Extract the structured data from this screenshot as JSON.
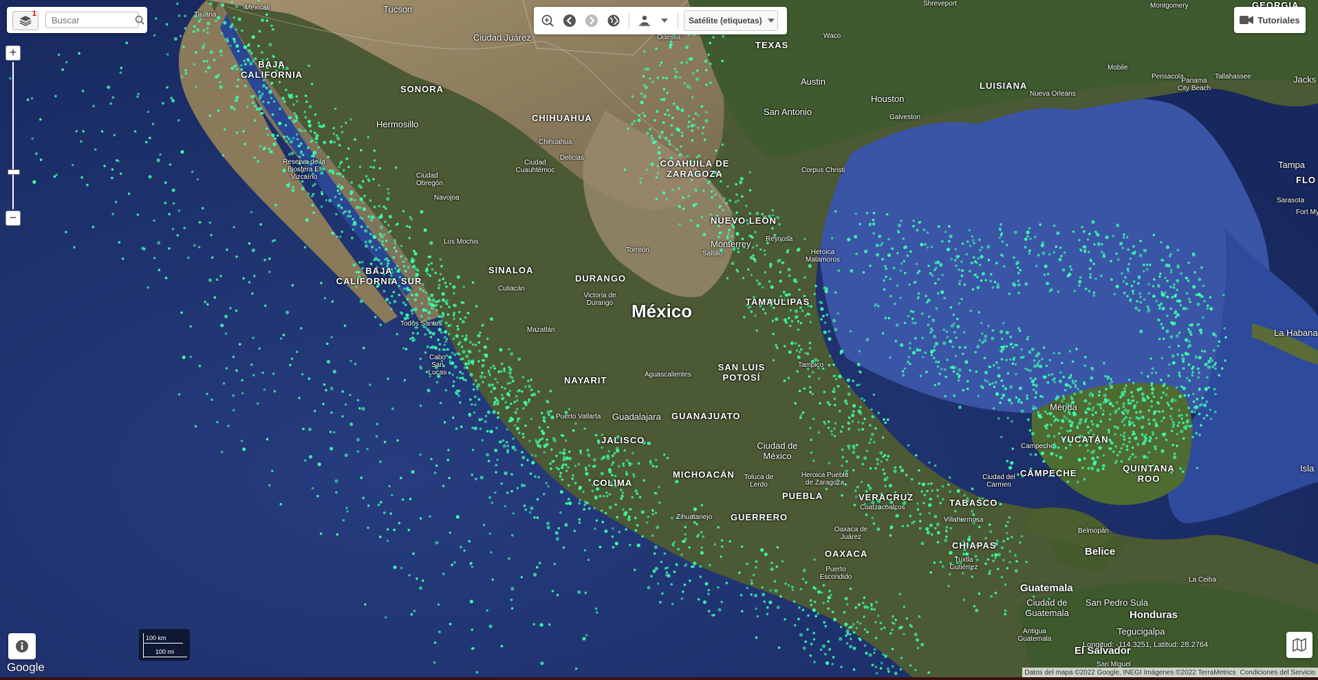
{
  "search": {
    "placeholder": "Buscar",
    "layers_badge": "1"
  },
  "toolbar": {
    "basemap": "Satélite (etiquetas)"
  },
  "tutorials": {
    "label": "Tutoriales"
  },
  "map_labels": {
    "mexicali": "Mexicali",
    "tucson": "Tucson",
    "ciudad_juarez": "Ciudad Juárez",
    "odessa": "Odessa",
    "shreveport": "Shreveport",
    "montgomery": "Montgomery",
    "georgia": "GEORGIA",
    "waco": "Waco",
    "texas": "TEXAS",
    "tijuana": "Tijuana",
    "baja_california": "BAJA CALIFORNIA",
    "sonora": "SONORA",
    "chihuahua_state": "CHIHUAHUA",
    "hermosillo": "Hermosillo",
    "chihuahua_city": "Chihuahua",
    "delicias": "Delicias",
    "coahuila": "COAHUILA DE ZARAGOZA",
    "austin": "Austin",
    "houston": "Houston",
    "luisiana": "LUISIANA",
    "mobile": "Mobile",
    "pensacola": "Pensacola",
    "tallahassee": "Tallahassee",
    "jacksonville": "Jacks",
    "panama_city": "Panama City Beach",
    "new_orleans": "Nueva Orleans",
    "galveston": "Galveston",
    "san_antonio": "San Antonio",
    "corpus_christi": "Corpus Christi",
    "tampa": "Tampa",
    "florida": "FLO",
    "sarasota": "Sarasota",
    "fort_myers": "Fort My",
    "vizcaino": "Reserva de la Biosfera El Vizcaíno",
    "ciudad_obregon": "Ciudad Obregón",
    "ciudad_cuauhtemoc": "Ciudad Cuauhtémoc",
    "navojoa": "Navojoa",
    "los_mochis": "Los Mochis",
    "culiacan": "Culiacán",
    "sinaloa": "SINALOA",
    "durango": "DURANGO",
    "torreon": "Torreón",
    "saltillo": "Saltillo",
    "monterrey": "Monterrey",
    "nuevo_leon": "NUEVO LEÓN",
    "reynosa": "Reynosa",
    "matamoros": "Heroica Matamoros",
    "bcs": "BAJA CALIFORNIA SUR",
    "mexico": "México",
    "tamaulipas": "TAMAULIPAS",
    "victoria_durango": "Victoria de Durango",
    "mazatlan": "Mazatlán",
    "todos_santos": "Todos Santos",
    "cabo": "Cabo San Lucas",
    "la_habana": "La Habana",
    "nayarit": "NAYARIT",
    "aguascalientes": "Aguascalientes",
    "san_luis_potosi": "SAN LUIS POTOSÍ",
    "tampico": "Tampico",
    "guadalajara": "Guadalajara",
    "guanajuato": "GUANAJUATO",
    "puerto_vallarta": "Puerto Vallarta",
    "jalisco": "JALISCO",
    "ciudad_de_mexico": "Ciudad de México",
    "colima": "COLIMA",
    "michoacan": "MICHOACÁN",
    "toluca": "Toluca de Lerdo",
    "puebla": "PUEBLA",
    "heroica_puebla": "Heroica Puebla de Zaragoza",
    "veracruz": "VERACRUZ",
    "coatzacoalcos": "Coatzacoalcos",
    "zihuatanejo": "Zihuatanejo",
    "guerrero": "GUERRERO",
    "oaxaca_city": "Oaxaca de Juárez",
    "oaxaca": "OAXACA",
    "puerto_escondido": "Puerto Escondido",
    "villahermosa": "Villahermosa",
    "tabasco": "TABASCO",
    "chiapas": "CHIAPAS",
    "tuxtla": "Tuxtla Gutiérrez",
    "merida": "Mérida",
    "yucatan": "YUCATÁN",
    "campeche_city": "Campeche",
    "campeche": "CAMPECHE",
    "ciudad_del_carmen": "Ciudad del Carmen",
    "quintana_roo": "QUINTANA ROO",
    "belmopan": "Belmopán",
    "belice": "Belice",
    "la_ceiba": "La Ceiba",
    "guatemala": "Guatemala",
    "ciudad_guatemala": "Ciudad de Guatemala",
    "antigua": "Antigua Guatemala",
    "san_pedro_sula": "San Pedro Sula",
    "honduras": "Honduras",
    "tegucigalpa": "Tegucigalpa",
    "el_salvador": "El Salvador",
    "san_miguel": "San Miguel",
    "isla": "Isla"
  },
  "scale": {
    "km": "100 km",
    "mi": "100 mi"
  },
  "footer": {
    "google": "Google",
    "coords": "Longitud: -114.3251, Latitud: 28.2764",
    "map_data": "Datos del mapa ©2022 Google, INEGI Imágenes ©2022 TerraMetrics",
    "terms": "Condiciones del Servicio"
  },
  "colors": {
    "land": "#4e5a36",
    "ocean": "#24397a",
    "gulf": "#3854a5",
    "points": "#3dffb0"
  }
}
